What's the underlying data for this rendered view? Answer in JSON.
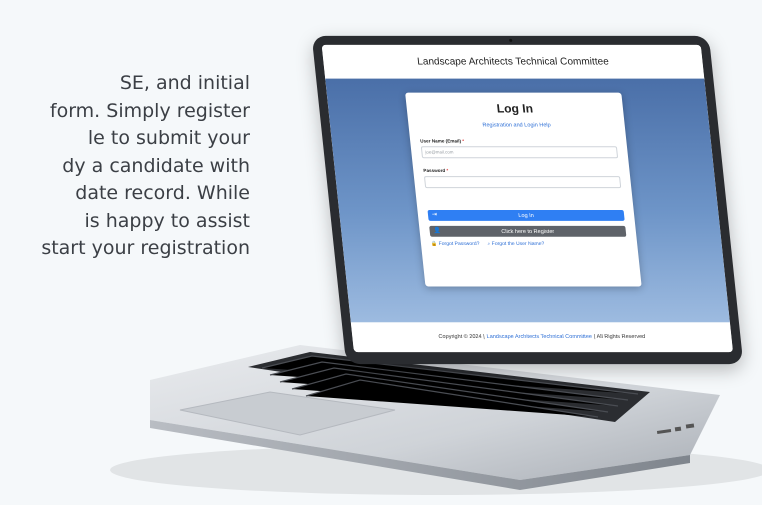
{
  "copy_lines": [
    "SE, and initial",
    "form. Simply register",
    "le to submit your",
    "dy a candidate with",
    "date record. While",
    "is happy to assist",
    "start your registration"
  ],
  "site": {
    "header_title": "Landscape Architects Technical Committee",
    "footer_prefix": "Copyright © 2024 |",
    "footer_link": "Landscape Architects Technical Committee",
    "footer_suffix": "| All Rights Reserved"
  },
  "login": {
    "title": "Log In",
    "help_link": "Registration and Login Help",
    "username_label": "User Name (Email)",
    "username_placeholder": "joe@mail.com",
    "password_label": "Password",
    "required_mark": "*",
    "login_button": "Log In",
    "register_button": "Click here to Register",
    "forgot_password": "Forgot Password?",
    "forgot_username": "Forgot the User Name?"
  },
  "icons": {
    "login_icon": "sign-in-icon",
    "register_icon": "user-icon",
    "lock_icon": "lock-icon",
    "search_icon": "search-icon"
  },
  "colors": {
    "primary": "#2f7ff3",
    "secondary": "#5f6369",
    "link": "#2d6fd6",
    "hero_top": "#4a6fa8",
    "hero_bottom": "#9dbbe0"
  }
}
